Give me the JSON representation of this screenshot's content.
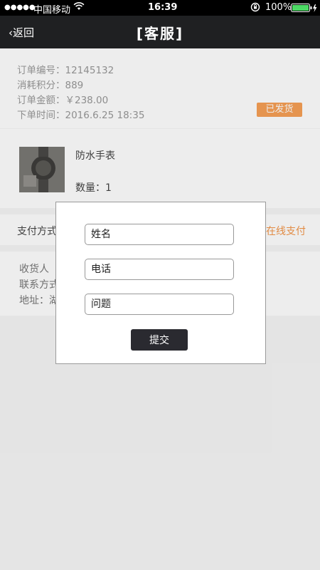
{
  "status_bar": {
    "signal": "●●●●●",
    "carrier": "中国移动",
    "wifi_icon": "wifi-icon",
    "time": "16:39",
    "battery": "100%"
  },
  "nav": {
    "back_label": "返回",
    "title": "[客服]"
  },
  "order": {
    "number": "订单编号：12145132",
    "points": "消耗积分：889",
    "amount": "订单金额：￥238.00",
    "time": "下单时间：2016.6.25    18:35",
    "status_badge": "已发货"
  },
  "product": {
    "name": "防水手表",
    "quantity": "数量：1"
  },
  "payment": {
    "label": "支付方式",
    "value": "在线支付"
  },
  "shipping": {
    "receiver": "收货人",
    "contact": "联系方式",
    "address": "地址：湖"
  },
  "modal": {
    "name_placeholder": "姓名",
    "phone_placeholder": "电话",
    "question_placeholder": "问题",
    "submit_label": "提交"
  },
  "colors": {
    "nav_bg": "#1f2022",
    "accent": "#f3964a",
    "badge": "#f7a055"
  }
}
